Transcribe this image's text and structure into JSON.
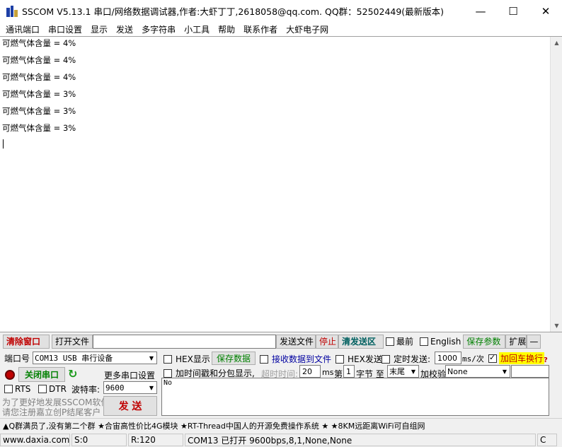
{
  "window": {
    "title": "SSCOM V5.13.1 串口/网络数据调试器,作者:大虾丁丁,2618058@qq.com. QQ群：52502449(最新版本)",
    "minimize": "—",
    "maximize": "☐",
    "close": "✕"
  },
  "menu": [
    "通讯端口",
    "串口设置",
    "显示",
    "发送",
    "多字符串",
    "小工具",
    "帮助",
    "联系作者",
    "大虾电子网"
  ],
  "receive": {
    "lines": [
      "可燃气体含量 = 4%",
      "可燃气体含量 = 4%",
      "可燃气体含量 = 4%",
      "可燃气体含量 = 3%",
      "可燃气体含量 = 3%",
      "可燃气体含量 = 3%"
    ]
  },
  "toolbar": {
    "clear": "清除窗口",
    "open_file": "打开文件",
    "file_path": "",
    "send_file": "发送文件",
    "stop": "停止",
    "send_area": "清发送区",
    "last": "最前",
    "english": "English",
    "save_params": "保存参数",
    "expand": "扩展",
    "collapse": "—"
  },
  "panel": {
    "port_label": "端口号",
    "port_value": "COM13 USB 串行设备",
    "close_port": "关闭串口",
    "more_settings": "更多串口设置",
    "rts": "RTS",
    "dtr": "DTR",
    "baud_label": "波特率:",
    "baud_value": "9600",
    "promo_line1": "为了更好地发展SSCOM软件",
    "promo_line2": "请您注册嘉立创P结尾客户",
    "send_button": "发 送",
    "hex_display": "HEX显示",
    "save_data": "保存数据",
    "recv_to_file": "接收数据到文件",
    "hex_send": "HEX发送",
    "timed_send": "定时发送:",
    "timed_value": "1000",
    "timed_unit": "ms/次",
    "add_crlf": "加回车换行",
    "timestamp": "加时间戳和分包显示,",
    "timeout_label": "超时时间:",
    "timeout_value": "20",
    "timeout_unit": "ms",
    "nth_label": "第",
    "nth_value": "1",
    "byte_to": "字节 至",
    "end_value": "末尾",
    "checksum_label": "加校验",
    "checksum_value": "None",
    "send_text": "No",
    "help_mark": "?"
  },
  "marquee": "▲Q群满员了,没有第二个群  ★合宙高性价比4G模块  ★RT-Thread中国人的开源免费操作系统  ★  ★8KM远距离WiFi可自组网",
  "status": {
    "site": "www.daxia.com",
    "sent": "S:0",
    "received": "R:120",
    "port_status": "COM13 已打开  9600bps,8,1,None,None",
    "flag": "C"
  },
  "colors": {
    "accent_red": "#c00000",
    "accent_green": "#008000",
    "crlf_highlight": "#ffff00"
  }
}
